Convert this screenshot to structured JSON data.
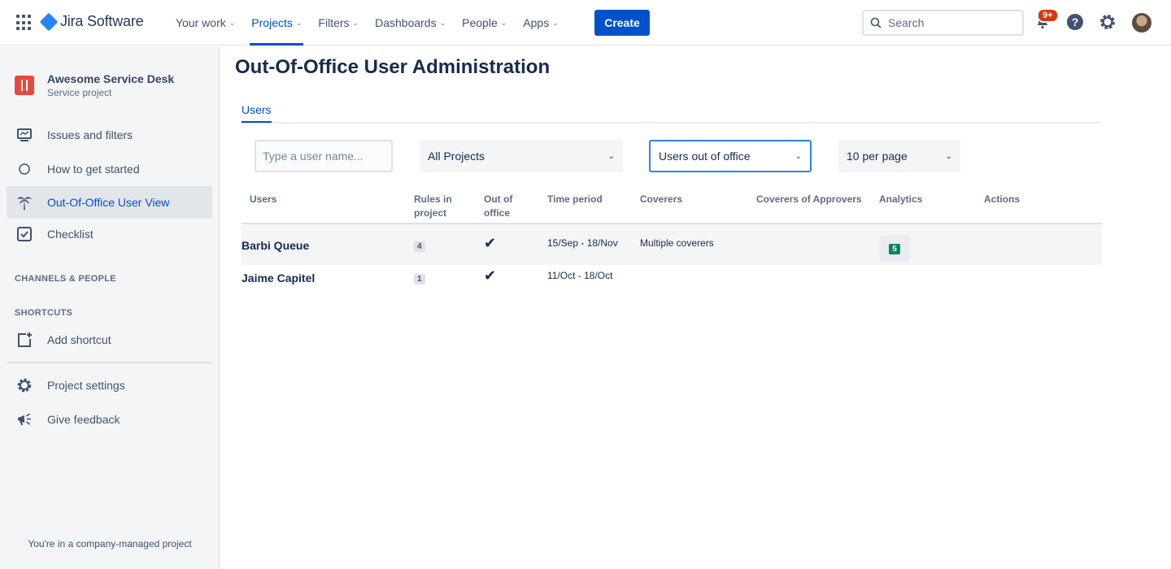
{
  "app": {
    "logo_text": "Jira Software",
    "nav": [
      {
        "label": "Your work",
        "active": false
      },
      {
        "label": "Projects",
        "active": true
      },
      {
        "label": "Filters",
        "active": false
      },
      {
        "label": "Dashboards",
        "active": false
      },
      {
        "label": "People",
        "active": false
      },
      {
        "label": "Apps",
        "active": false
      }
    ],
    "create_label": "Create",
    "search_placeholder": "Search",
    "notifications_badge": "9+"
  },
  "sidebar": {
    "project_name": "Awesome Service Desk",
    "project_type": "Service project",
    "items": [
      {
        "label": "Issues and filters",
        "icon": "monitor-icon"
      },
      {
        "label": "How to get started",
        "icon": "circle-icon"
      },
      {
        "label": "Out-Of-Office User View",
        "icon": "palm-tree-icon",
        "active": true
      },
      {
        "label": "Checklist",
        "icon": "checkbox-icon"
      }
    ],
    "section_channels": "CHANNELS & PEOPLE",
    "section_shortcuts": "SHORTCUTS",
    "add_shortcut": "Add shortcut",
    "project_settings": "Project settings",
    "give_feedback": "Give feedback",
    "footer": "You're in a company-managed project"
  },
  "main": {
    "title": "Out-Of-Office User Administration",
    "tabs": [
      {
        "label": "Users",
        "active": true
      }
    ],
    "filters": {
      "user_placeholder": "Type a user name...",
      "project_select": "All Projects",
      "status_select": "Users out of office",
      "page_size_select": "10 per page"
    },
    "columns": {
      "users": "Users",
      "rules_line1": "Rules in",
      "rules_line2": "project",
      "ooo_line1": "Out of",
      "ooo_line2": "office",
      "time_period": "Time period",
      "coverers": "Coverers",
      "coverers_of_approvers": "Coverers of Approvers",
      "analytics": "Analytics",
      "actions": "Actions"
    },
    "rows": [
      {
        "user": "Barbi Queue",
        "rules": "4",
        "out_of_office": "✔",
        "time_period": "15/Sep - 18/Nov",
        "coverers": "Multiple coverers",
        "coverers_of_approvers": "",
        "analytics": "5"
      },
      {
        "user": "Jaime Capitel",
        "rules": "1",
        "out_of_office": "✔",
        "time_period": "11/Oct - 18/Oct",
        "coverers": "",
        "coverers_of_approvers": "",
        "analytics": ""
      }
    ]
  }
}
